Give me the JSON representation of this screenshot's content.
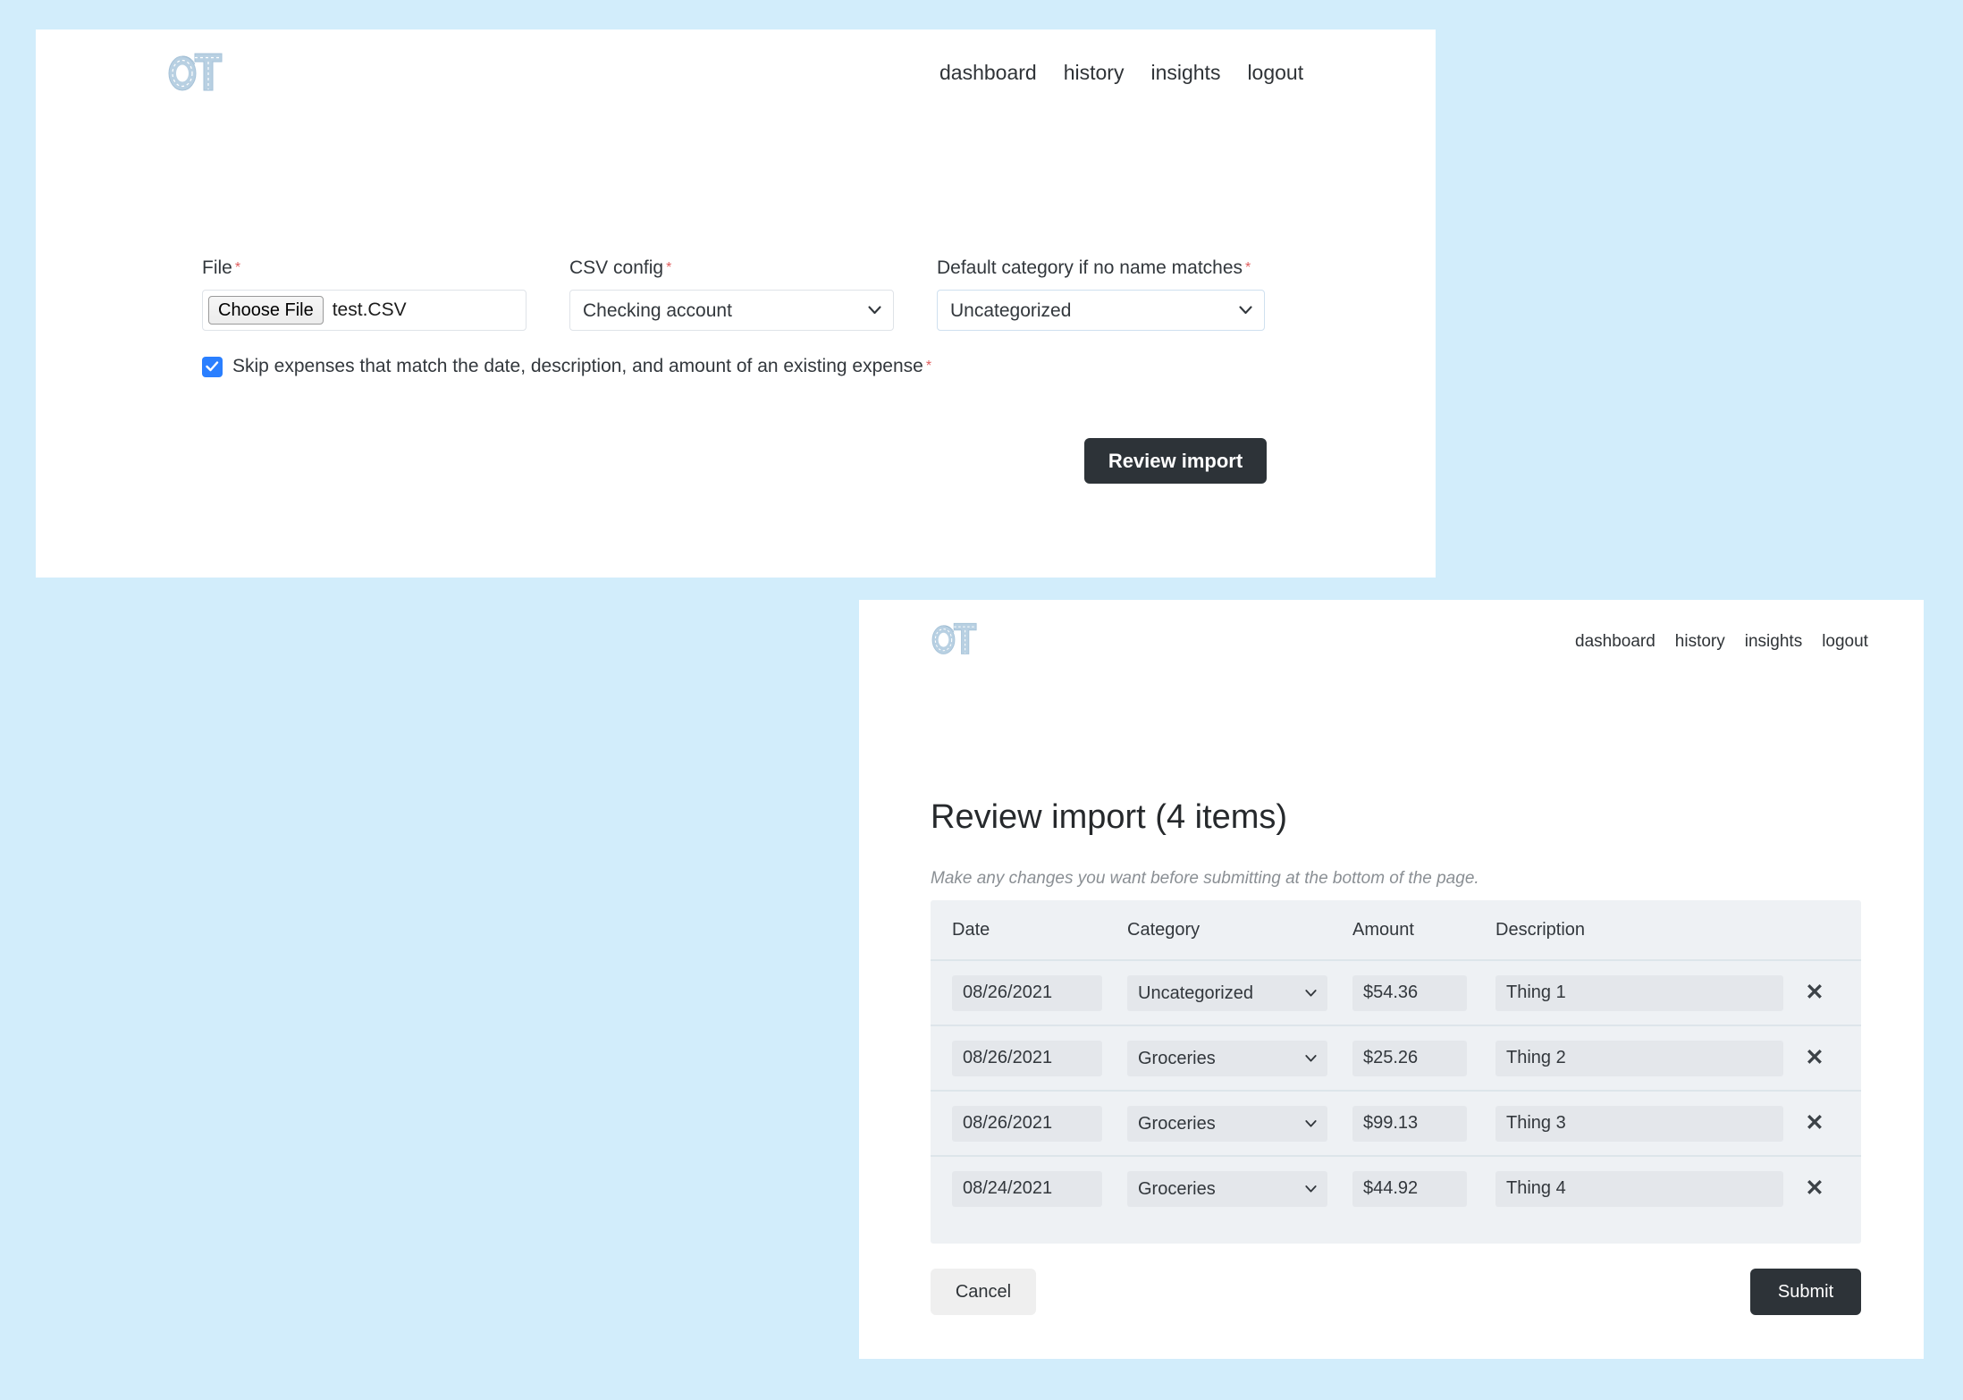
{
  "theme": {
    "page_background": "#d2edfb",
    "panel_background": "#ffffff",
    "accent_dark": "#2d3338",
    "accent_blue": "#2a7fff",
    "required_marker": "#e05d5d",
    "table_background": "#eef1f4",
    "input_background": "#e4e7eb",
    "logo_color": "#b6cfe0"
  },
  "nav": {
    "logo_text": "OT",
    "links": [
      {
        "label": "dashboard"
      },
      {
        "label": "history"
      },
      {
        "label": "insights"
      },
      {
        "label": "logout"
      }
    ]
  },
  "upload_page": {
    "fields": {
      "file": {
        "label": "File",
        "required_marker": "*",
        "button_label": "Choose File",
        "value": "test.CSV"
      },
      "csv_config": {
        "label": "CSV config",
        "required_marker": "*",
        "value": "Checking account",
        "options": [
          "Checking account"
        ]
      },
      "default_category": {
        "label": "Default category if no name matches",
        "required_marker": "*",
        "value": "Uncategorized",
        "options": [
          "Uncategorized"
        ]
      }
    },
    "skip_duplicates": {
      "label": "Skip expenses that match the date, description, and amount of an existing expense",
      "required_marker": "*",
      "checked": true,
      "check_glyph": "✔"
    },
    "submit_button": "Review import"
  },
  "review_page": {
    "title": "Review import (4 items)",
    "subtitle": "Make any changes you want before submitting at the bottom of the page.",
    "columns": {
      "date": "Date",
      "category": "Category",
      "amount": "Amount",
      "description": "Description"
    },
    "rows": [
      {
        "date": "08/26/2021",
        "category": "Uncategorized",
        "amount": "$54.36",
        "description": "Thing 1",
        "delete_glyph": "✕"
      },
      {
        "date": "08/26/2021",
        "category": "Groceries",
        "amount": "$25.26",
        "description": "Thing 2",
        "delete_glyph": "✕"
      },
      {
        "date": "08/26/2021",
        "category": "Groceries",
        "amount": "$99.13",
        "description": "Thing 3",
        "delete_glyph": "✕"
      },
      {
        "date": "08/24/2021",
        "category": "Groceries",
        "amount": "$44.92",
        "description": "Thing 4",
        "delete_glyph": "✕"
      }
    ],
    "category_options": [
      "Uncategorized",
      "Groceries"
    ],
    "cancel_button": "Cancel",
    "submit_button": "Submit"
  }
}
